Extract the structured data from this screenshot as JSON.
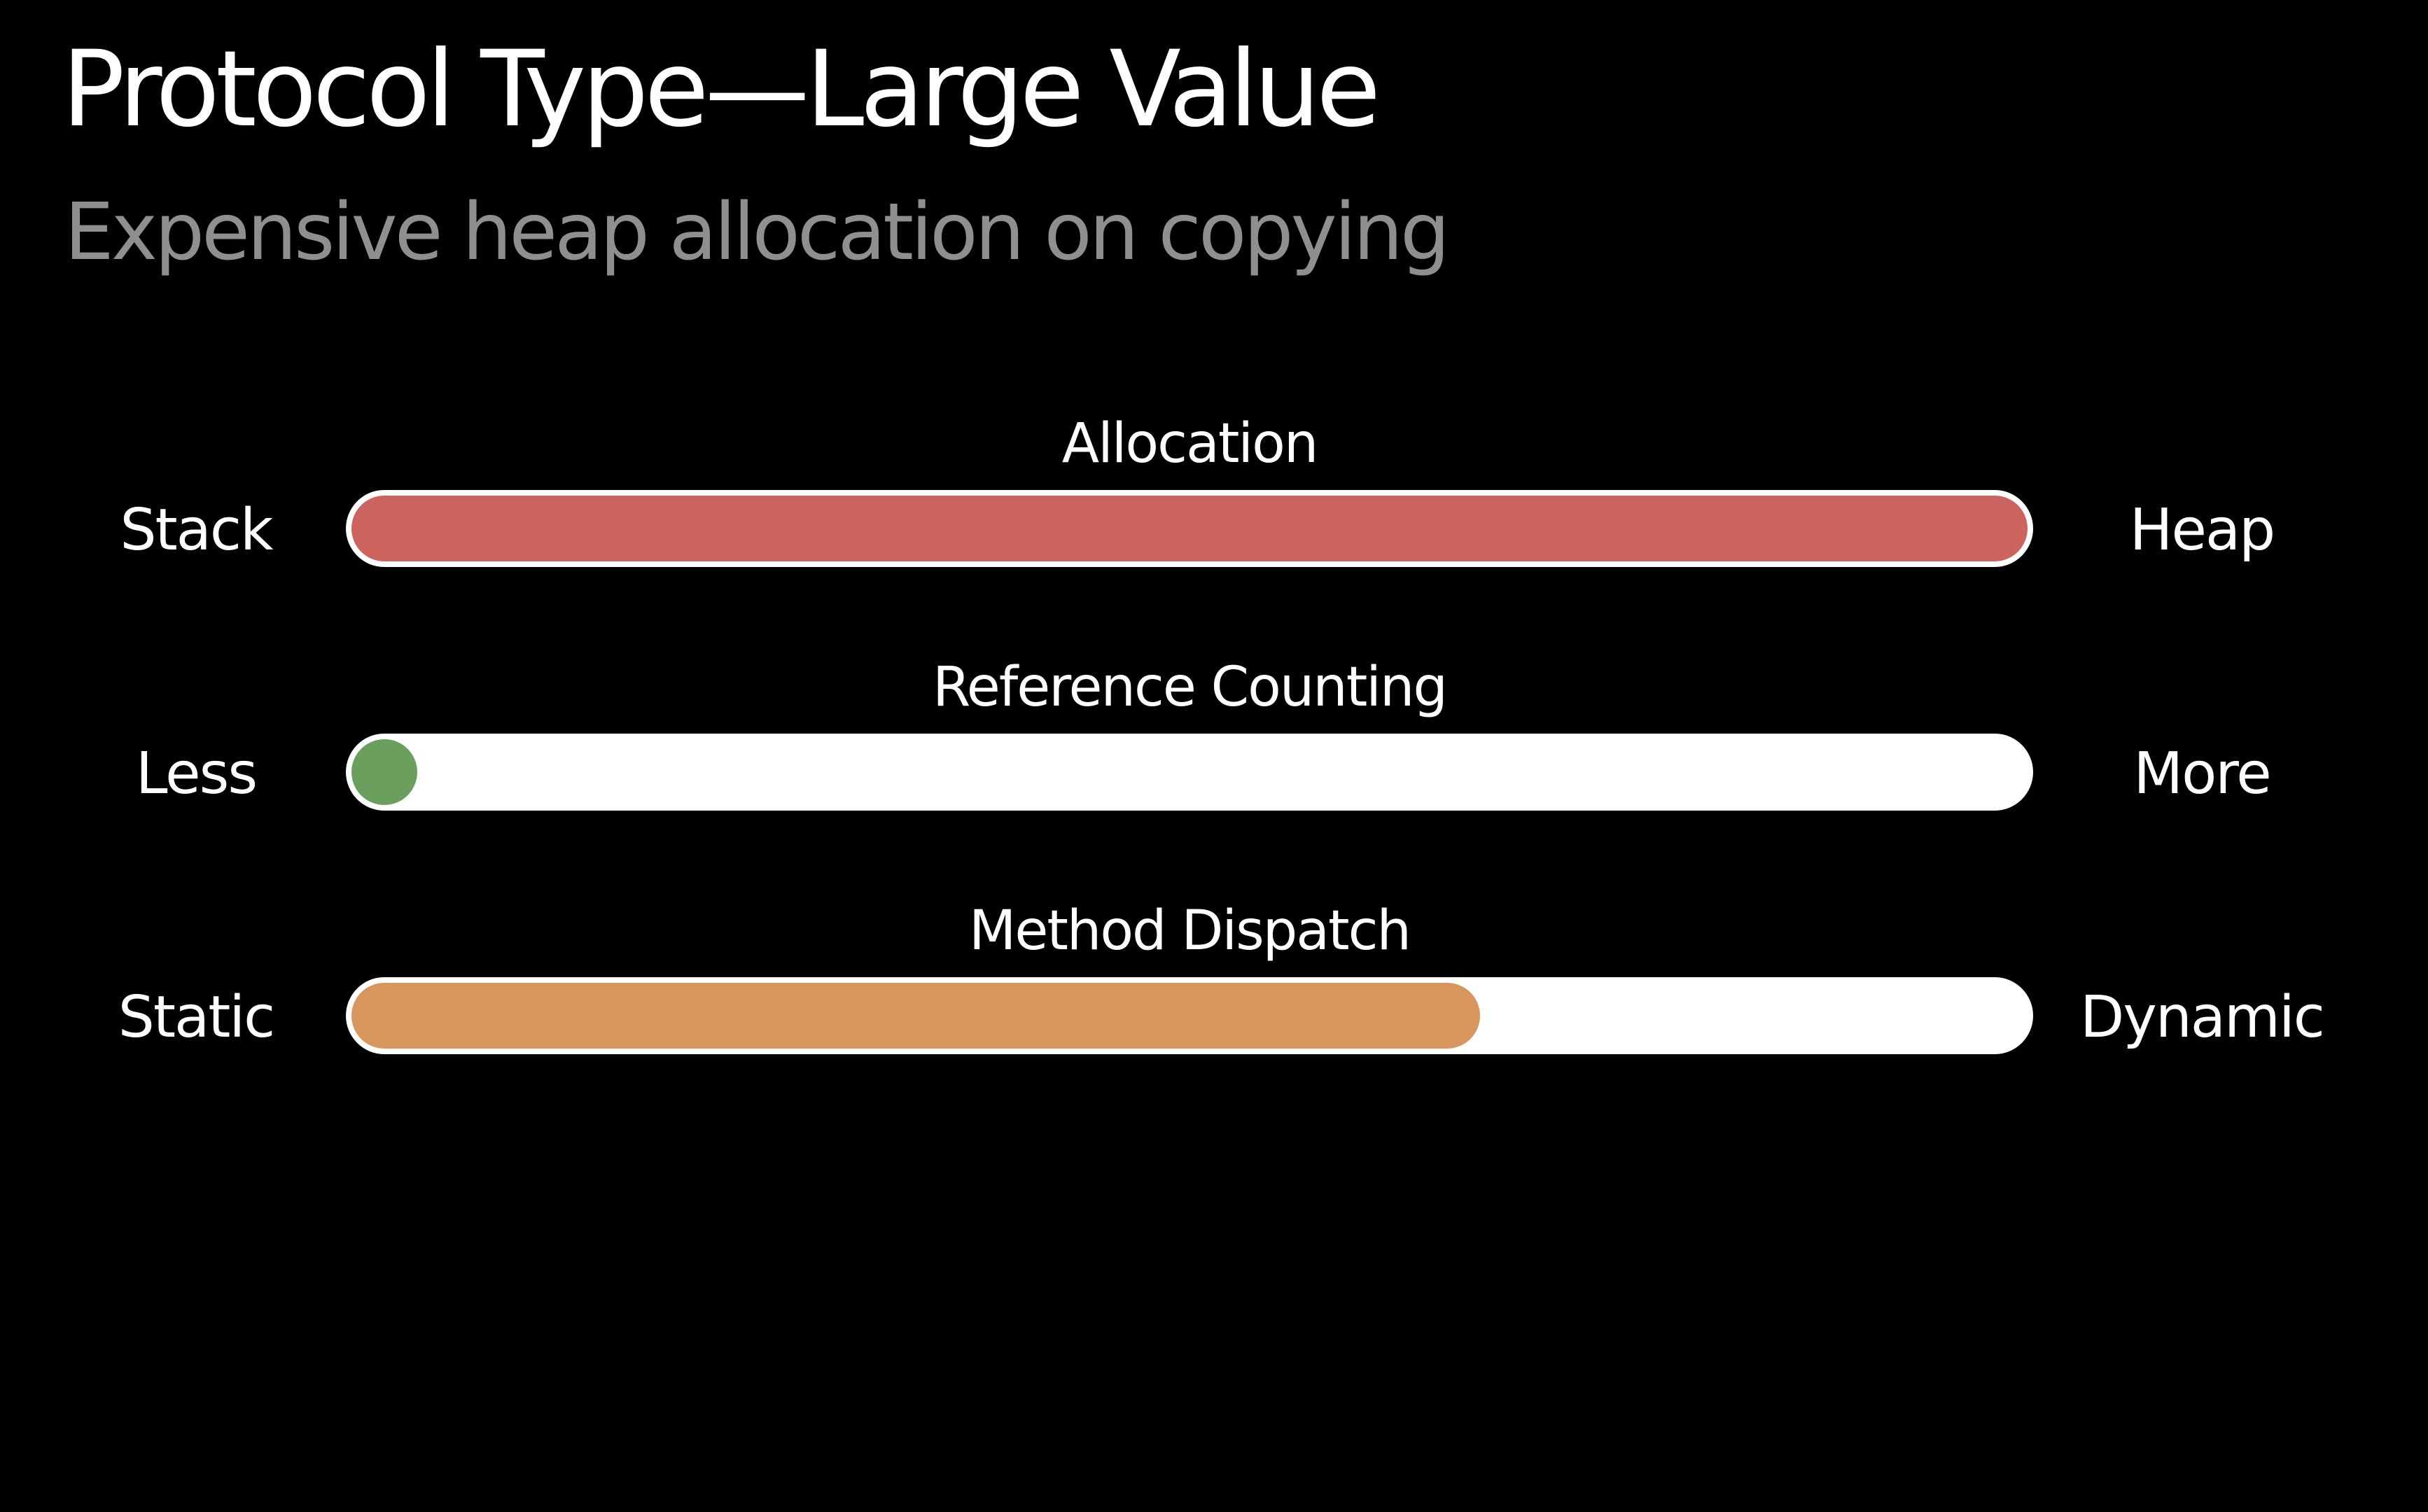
{
  "slide": {
    "title": "Protocol Type—Large Value",
    "subtitle": "Expensive heap allocation on copying"
  },
  "meters": [
    {
      "title": "Allocation",
      "left_label": "Stack",
      "right_label": "Heap",
      "fill_fraction": 1.0,
      "fill_color": "#cb635e"
    },
    {
      "title": "Reference Counting",
      "left_label": "Less",
      "right_label": "More",
      "fill_fraction": 0.0,
      "fill_color": "#6a9f5e"
    },
    {
      "title": "Method Dispatch",
      "left_label": "Static",
      "right_label": "Dynamic",
      "fill_fraction": 0.66,
      "fill_color": "#d9955e"
    }
  ],
  "colors": {
    "background": "#000000",
    "title": "#ffffff",
    "subtitle": "#8f8f8f",
    "track": "#ffffff"
  }
}
